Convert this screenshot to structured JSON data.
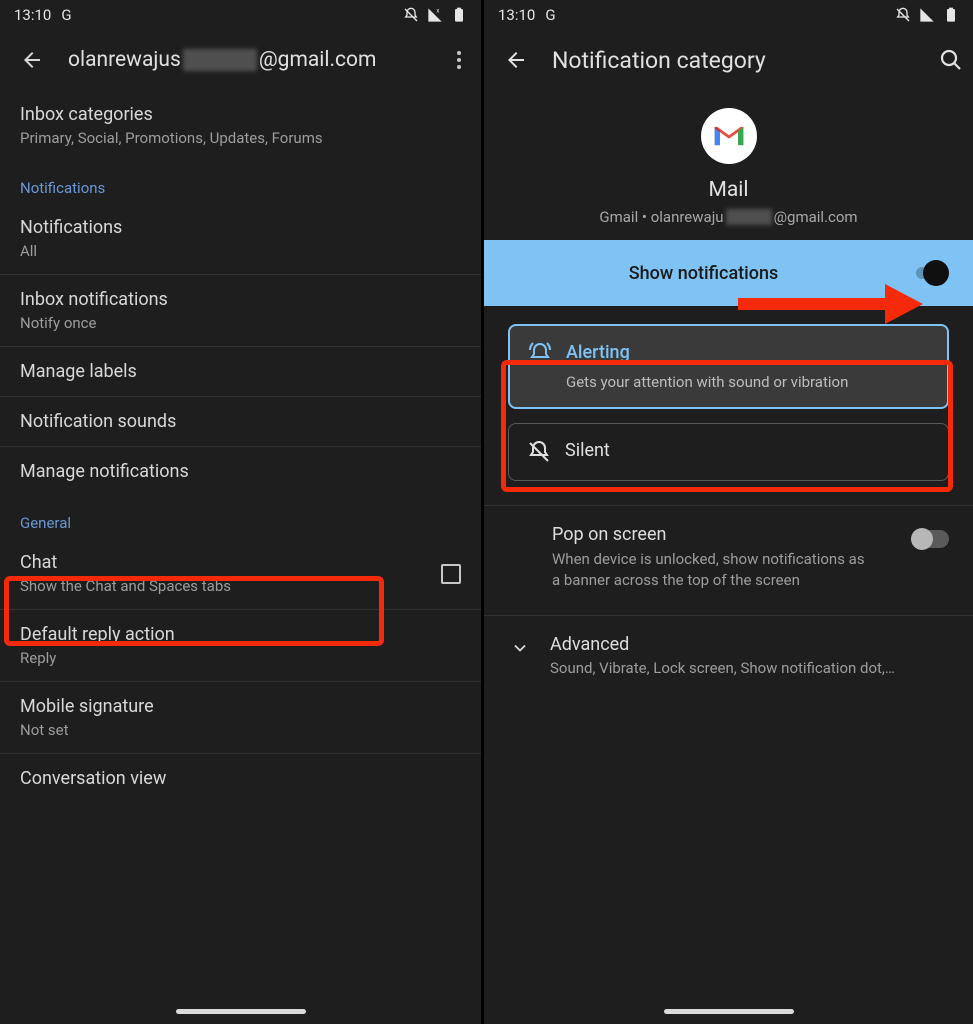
{
  "left": {
    "status": {
      "time": "13:10",
      "g": "G"
    },
    "header": {
      "email_prefix": "olanrewajus",
      "email_suffix": "@gmail.com"
    },
    "inbox_categories": {
      "title": "Inbox categories",
      "subtitle": "Primary, Social, Promotions, Updates, Forums"
    },
    "section_notifications": "Notifications",
    "notifications": {
      "title": "Notifications",
      "subtitle": "All"
    },
    "inbox_notifications": {
      "title": "Inbox notifications",
      "subtitle": "Notify once"
    },
    "manage_labels": "Manage labels",
    "notification_sounds": "Notification sounds",
    "manage_notifications": "Manage notifications",
    "section_general": "General",
    "chat": {
      "title": "Chat",
      "subtitle": "Show the Chat and Spaces tabs"
    },
    "default_reply": {
      "title": "Default reply action",
      "subtitle": "Reply"
    },
    "mobile_signature": {
      "title": "Mobile signature",
      "subtitle": "Not set"
    },
    "conversation_view": "Conversation view"
  },
  "right": {
    "status": {
      "time": "13:10",
      "g": "G"
    },
    "header": {
      "title": "Notification category"
    },
    "app": {
      "name": "Mail",
      "sub_prefix": "Gmail • olanrewaju",
      "sub_suffix": "@gmail.com"
    },
    "show_notifications": "Show notifications",
    "alerting": {
      "title": "Alerting",
      "desc": "Gets your attention with sound or vibration"
    },
    "silent": "Silent",
    "pop": {
      "title": "Pop on screen",
      "desc": "When device is unlocked, show notifications as a banner across the top of the screen"
    },
    "advanced": {
      "title": "Advanced",
      "desc": "Sound, Vibrate, Lock screen, Show notification dot,…"
    }
  }
}
